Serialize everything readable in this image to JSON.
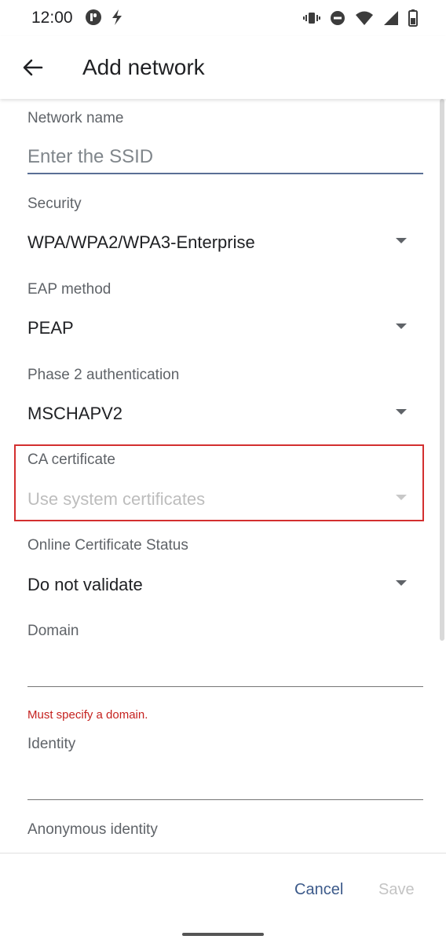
{
  "status_bar": {
    "time": "12:00",
    "left_icons": [
      "app-notification-icon",
      "charging-bolt-icon"
    ],
    "right_icons": [
      "vibrate-icon",
      "do-not-disturb-icon",
      "wifi-icon",
      "cellular-signal-icon",
      "battery-icon"
    ]
  },
  "app_bar": {
    "title": "Add network",
    "back_icon": "arrow-back-icon"
  },
  "form": {
    "network_name": {
      "label": "Network name",
      "placeholder": "Enter the SSID",
      "value": ""
    },
    "security": {
      "label": "Security",
      "value": "WPA/WPA2/WPA3-Enterprise"
    },
    "eap_method": {
      "label": "EAP method",
      "value": "PEAP"
    },
    "phase2": {
      "label": "Phase 2 authentication",
      "value": "MSCHAPV2"
    },
    "ca_certificate": {
      "label": "CA certificate",
      "value": "Use system certificates",
      "disabled": true
    },
    "ocsp": {
      "label": "Online Certificate Status",
      "value": "Do not validate"
    },
    "domain": {
      "label": "Domain",
      "value": "",
      "error": "Must specify a domain."
    },
    "identity": {
      "label": "Identity",
      "value": ""
    },
    "anonymous_identity": {
      "label": "Anonymous identity"
    }
  },
  "footer": {
    "cancel_label": "Cancel",
    "save_label": "Save"
  },
  "colors": {
    "accent": "#5a6f95",
    "error": "#c5221f",
    "highlight": "#d32f2f",
    "button_text": "#3c5a8a"
  }
}
